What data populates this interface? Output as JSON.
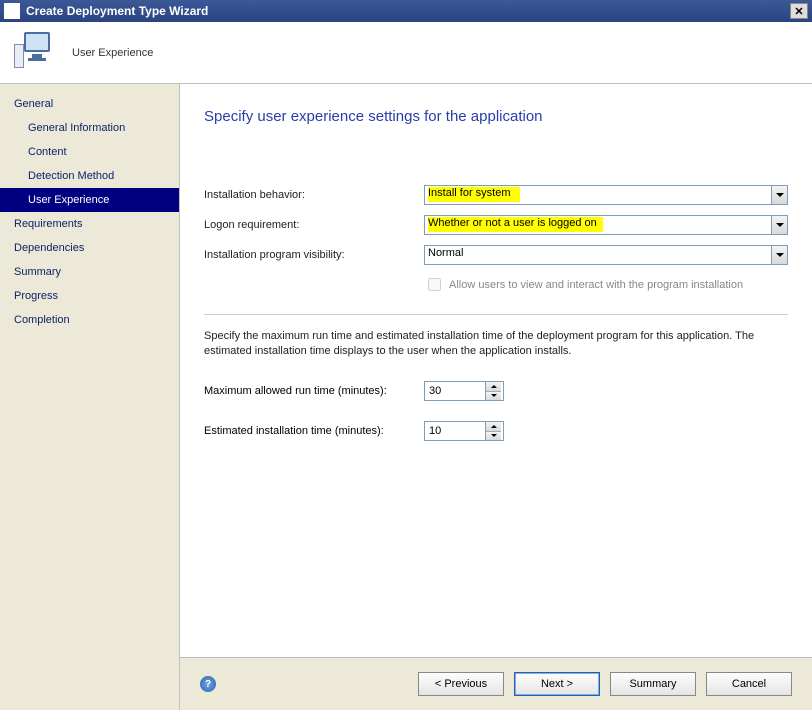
{
  "titlebar": {
    "title": "Create Deployment Type Wizard"
  },
  "header": {
    "step_label": "User Experience"
  },
  "sidebar": {
    "items": [
      {
        "label": "General",
        "sub": false
      },
      {
        "label": "General Information",
        "sub": true
      },
      {
        "label": "Content",
        "sub": true
      },
      {
        "label": "Detection Method",
        "sub": true
      },
      {
        "label": "User Experience",
        "sub": true,
        "selected": true
      },
      {
        "label": "Requirements",
        "sub": false
      },
      {
        "label": "Dependencies",
        "sub": false
      },
      {
        "label": "Summary",
        "sub": false
      },
      {
        "label": "Progress",
        "sub": false
      },
      {
        "label": "Completion",
        "sub": false
      }
    ]
  },
  "page": {
    "title": "Specify user experience settings for the application",
    "labels": {
      "install_behavior": "Installation behavior:",
      "logon_req": "Logon requirement:",
      "visibility": "Installation program visibility:",
      "allow_interact": "Allow users to view and interact with the program installation",
      "desc": "Specify the maximum run time and estimated installation time of the deployment program for this application. The estimated installation time displays to the user when the application installs.",
      "max_runtime": "Maximum allowed run time (minutes):",
      "est_time": "Estimated installation time (minutes):"
    },
    "values": {
      "install_behavior": "Install for system",
      "logon_req": "Whether or not a user is logged on",
      "visibility": "Normal",
      "allow_interact_checked": false,
      "allow_interact_enabled": false,
      "max_runtime": "30",
      "est_time": "10"
    }
  },
  "footer": {
    "previous": "< Previous",
    "next": "Next >",
    "summary": "Summary",
    "cancel": "Cancel"
  }
}
